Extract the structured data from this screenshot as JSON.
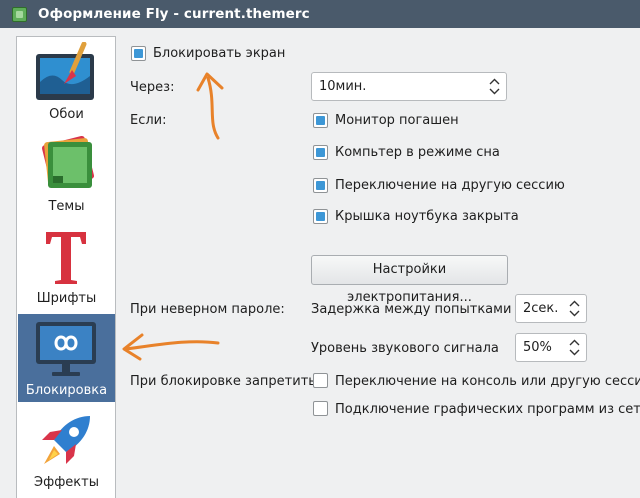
{
  "window": {
    "title": "Оформление Fly - current.themerc",
    "app_icon": "theme-app-icon"
  },
  "sidebar": {
    "items": [
      {
        "label": "Обои",
        "icon": "wallpaper-icon",
        "active": false
      },
      {
        "label": "Темы",
        "icon": "themes-icon",
        "active": false
      },
      {
        "label": "Шрифты",
        "icon": "fonts-icon",
        "active": false
      },
      {
        "label": "Блокировка",
        "icon": "lock-screen-icon",
        "active": true
      },
      {
        "label": "Эффекты",
        "icon": "effects-icon",
        "active": false
      }
    ],
    "active_color": "#4a6f9c"
  },
  "main": {
    "lock_screen_label": "Блокировать экран",
    "lock_screen_checked": true,
    "after_label": "Через:",
    "after_value": "10мин.",
    "if_label": "Если:",
    "conditions": [
      {
        "label": "Монитор погашен",
        "checked": true
      },
      {
        "label": "Компьтер в режиме сна",
        "checked": true
      },
      {
        "label": "Переключение на другую сессию",
        "checked": true
      },
      {
        "label": "Крышка ноутбука закрыта",
        "checked": true
      }
    ],
    "power_button_label": "Настройки электропитания...",
    "wrong_password_label": "При неверном пароле:",
    "delay_label": "Задержка между попытками",
    "delay_value": "2сек.",
    "beep_label": "Уровень звукового сигнала",
    "beep_value": "50%",
    "forbid_label": "При блокировке запретить:",
    "forbid_options": [
      {
        "label": "Переключение на консоль или другую сессию",
        "checked": false
      },
      {
        "label": "Подключение графических программ из сети",
        "checked": false
      }
    ]
  },
  "colors": {
    "titlebar": "#4a5a6b",
    "checkbox_fill": "#3d97d6",
    "annotation": "#e8822a"
  }
}
